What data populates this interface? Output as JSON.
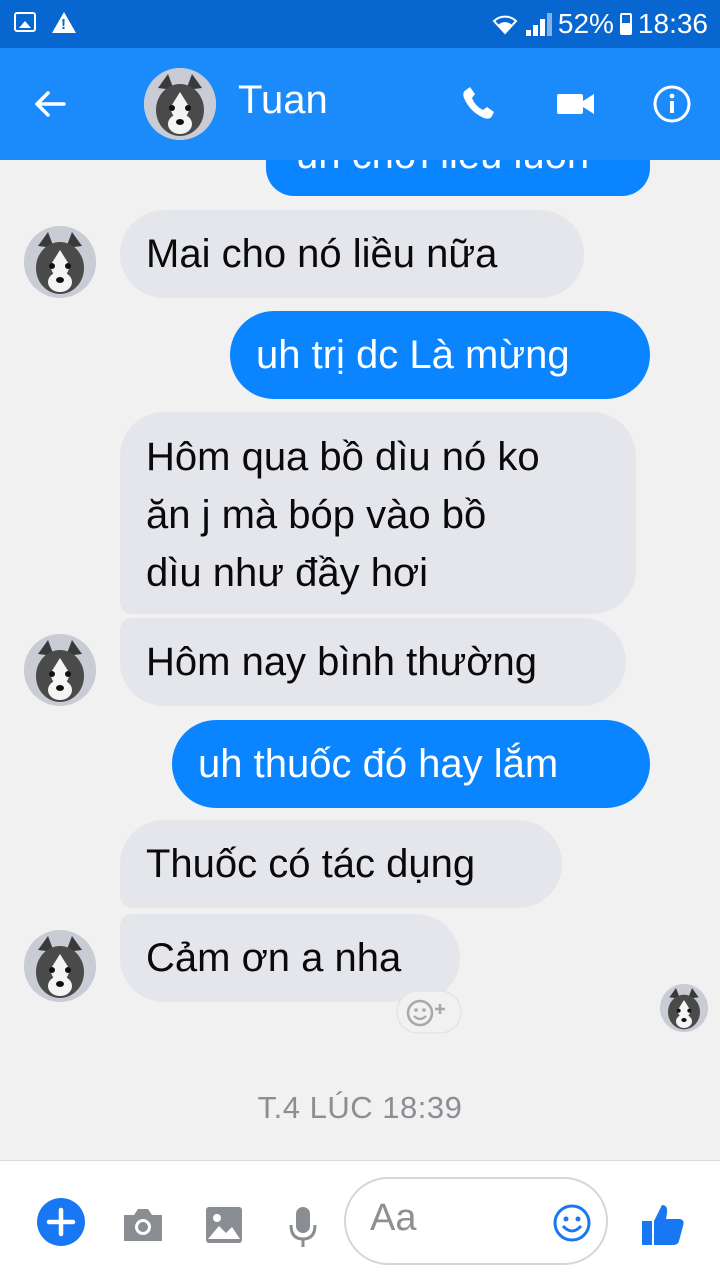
{
  "status_bar": {
    "battery": "52%",
    "time": "18:36"
  },
  "header": {
    "contact_name": "Tuan"
  },
  "messages": [
    {
      "side": "out",
      "text": "uh chơi liều luôn",
      "partial": true
    },
    {
      "side": "in",
      "text": "Mai cho nó liều nữa"
    },
    {
      "side": "out",
      "text": "uh trị dc Là mừng"
    },
    {
      "side": "in",
      "lines": [
        "Hôm qua bồ dìu nó ko",
        "ăn j mà bóp vào bồ",
        "dìu như đầy hơi"
      ]
    },
    {
      "side": "in",
      "text": "Hôm nay bình thường"
    },
    {
      "side": "out",
      "text": "uh thuốc đó hay lắm"
    },
    {
      "side": "in",
      "text": "Thuốc có tác dụng"
    },
    {
      "side": "in",
      "text": "Cảm ơn a nha"
    }
  ],
  "timestamp": "T.4 LÚC 18:39",
  "composer": {
    "placeholder": "Aa"
  },
  "colors": {
    "status_bar": "#0866d0",
    "header": "#1b8bfb",
    "outgoing_bubble": "#0a84ff",
    "incoming_bubble": "#e4e6eb",
    "accent": "#1877f2"
  },
  "icons": [
    "back-arrow-icon",
    "phone-icon",
    "video-camera-icon",
    "info-icon",
    "add-icon",
    "camera-icon",
    "gallery-icon",
    "microphone-icon",
    "emoji-icon",
    "thumbs-up-icon",
    "add-reaction-icon"
  ]
}
